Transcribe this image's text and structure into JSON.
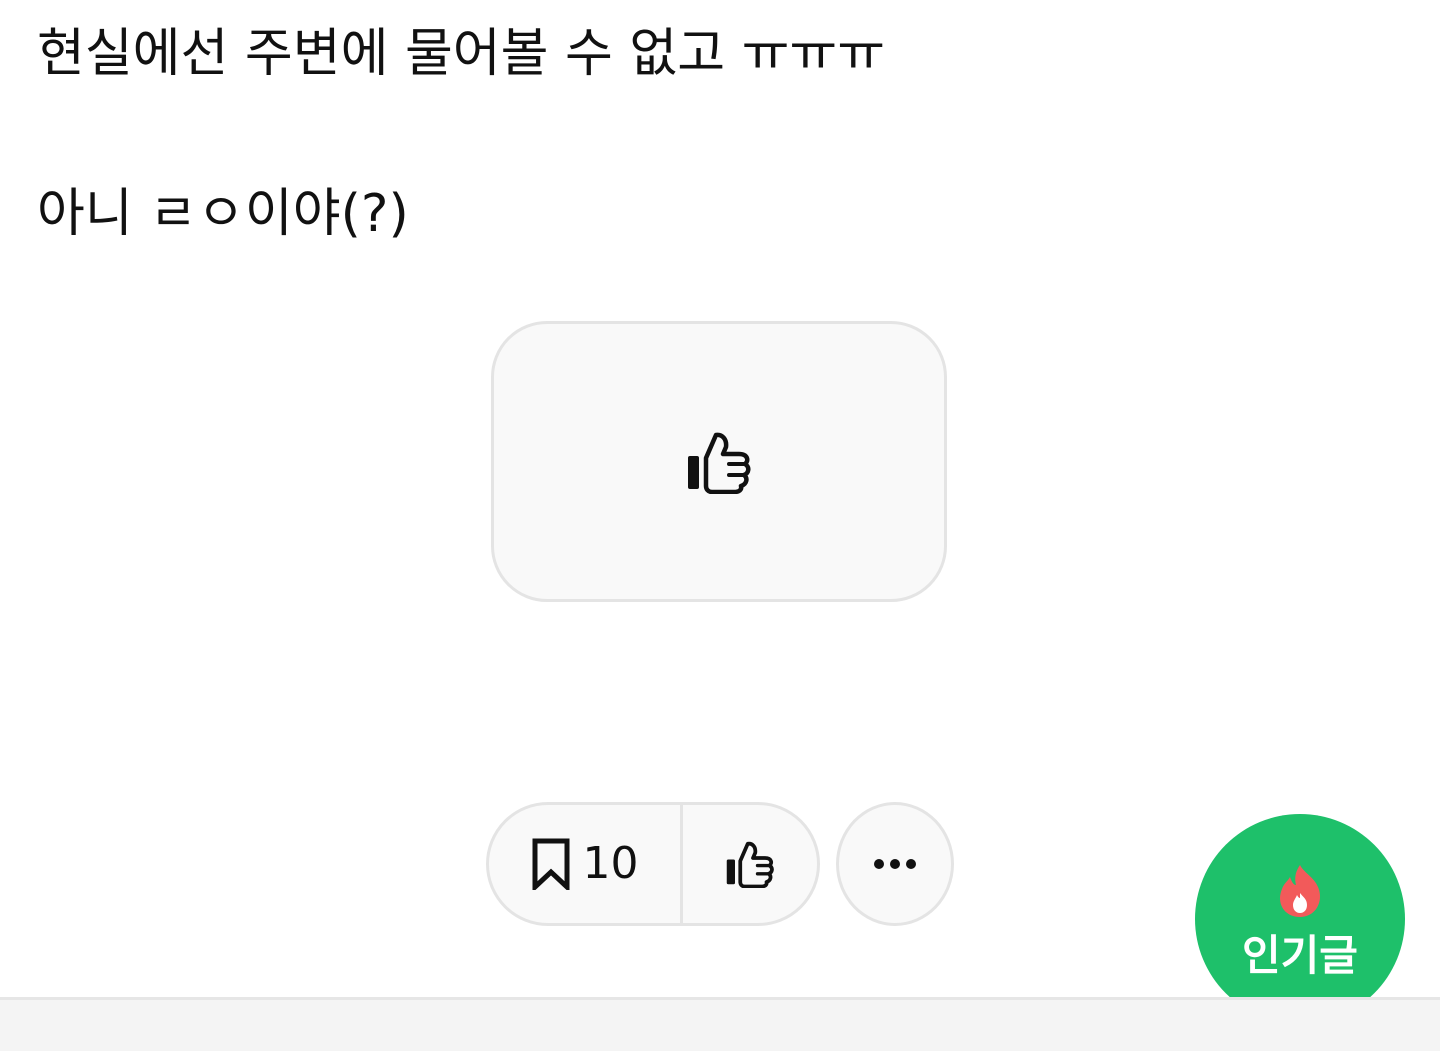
{
  "post": {
    "lines": [
      "현실에선 주변에 물어볼 수 없고 ㅠㅠㅠ",
      "아니 ㄹㅇ이야(?)"
    ]
  },
  "like_card": {
    "icon": "thumbs-up-icon"
  },
  "actions": {
    "bookmark_icon": "bookmark-icon",
    "bookmark_count": "10",
    "like_icon": "thumbs-up-icon",
    "more_icon": "more-horizontal-icon"
  },
  "popular_button": {
    "icon": "flame-icon",
    "label": "인기글",
    "background": "#1ec06a",
    "icon_color": "#f25a5a"
  },
  "colors": {
    "text": "#111111",
    "border": "#e4e4e4",
    "button_background": "#f9f9f9"
  }
}
